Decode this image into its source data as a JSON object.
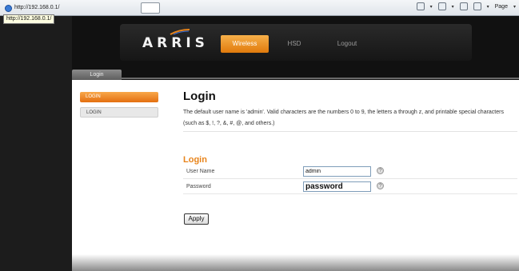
{
  "browser": {
    "url": "http://192.168.0.1/",
    "tooltip": "http://192.168.0.1/",
    "page_menu": "Page",
    "arrow": "▾"
  },
  "header": {
    "logo": "ARRIS",
    "nav": [
      {
        "label": "Wireless",
        "active": true
      },
      {
        "label": "HSD",
        "active": false
      },
      {
        "label": "Logout",
        "active": false
      }
    ]
  },
  "subtab": {
    "label": "Login"
  },
  "sidebar": {
    "items": [
      {
        "label": "LOGIN",
        "active": true
      },
      {
        "label": "LOGIN",
        "active": false
      }
    ]
  },
  "main": {
    "title": "Login",
    "description": "The default user name is 'admin'. Valid characters are the numbers 0 to 9, the letters a through z, and printable special characters (such as $, !, ?, &, #, @, and others.)",
    "section_title": "Login",
    "fields": [
      {
        "label": "User Name",
        "value": "admin",
        "help": "?"
      },
      {
        "label": "Password",
        "value": "password",
        "help": "?"
      }
    ],
    "apply_label": "Apply"
  },
  "colors": {
    "accent": "#e8841b",
    "header_bg": "#161616",
    "page_bg": "#111111"
  }
}
